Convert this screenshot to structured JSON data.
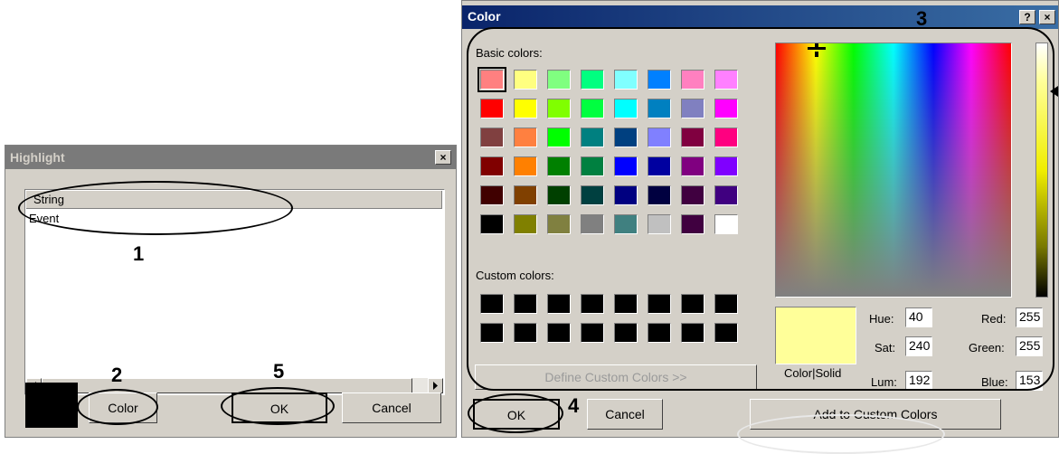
{
  "highlight_dialog": {
    "title": "Highlight",
    "close_glyph": "×",
    "list": {
      "column_header": "String",
      "rows": [
        "Event"
      ]
    },
    "swatch_color": "#000000",
    "buttons": {
      "color": "Color",
      "ok": "OK",
      "cancel": "Cancel"
    }
  },
  "color_dialog": {
    "title": "Color",
    "help_glyph": "?",
    "close_glyph": "×",
    "basic_colors_label": "Basic colors:",
    "custom_colors_label": "Custom colors:",
    "basic_colors": [
      [
        "#ff8080",
        "#ffff80",
        "#80ff80",
        "#00ff80",
        "#80ffff",
        "#0080ff",
        "#ff80c0",
        "#ff80ff"
      ],
      [
        "#ff0000",
        "#ffff00",
        "#80ff00",
        "#00ff40",
        "#00ffff",
        "#0080c0",
        "#8080c0",
        "#ff00ff"
      ],
      [
        "#804040",
        "#ff8040",
        "#00ff00",
        "#008080",
        "#004080",
        "#8080ff",
        "#800040",
        "#ff0080"
      ],
      [
        "#800000",
        "#ff8000",
        "#008000",
        "#008040",
        "#0000ff",
        "#0000a0",
        "#800080",
        "#8000ff"
      ],
      [
        "#400000",
        "#804000",
        "#004000",
        "#004040",
        "#000080",
        "#000040",
        "#400040",
        "#400080"
      ],
      [
        "#000000",
        "#808000",
        "#808040",
        "#808080",
        "#408080",
        "#c0c0c0",
        "#400040",
        "#ffffff"
      ]
    ],
    "custom_colors": [
      [
        "#000000",
        "#000000",
        "#000000",
        "#000000",
        "#000000",
        "#000000",
        "#000000",
        "#000000"
      ],
      [
        "#000000",
        "#000000",
        "#000000",
        "#000000",
        "#000000",
        "#000000",
        "#000000",
        "#000000"
      ]
    ],
    "define_custom_label": "Define Custom Colors >>",
    "color_solid_label": "Color|Solid",
    "preview_color": "#ffff99",
    "fields": {
      "hue_label": "Hue:",
      "hue": "40",
      "sat_label": "Sat:",
      "sat": "240",
      "lum_label": "Lum:",
      "lum": "192",
      "red_label": "Red:",
      "red": "255",
      "green_label": "Green:",
      "green": "255",
      "blue_label": "Blue:",
      "blue": "153"
    },
    "buttons": {
      "ok": "OK",
      "cancel": "Cancel",
      "add_custom": "Add to Custom Colors"
    }
  },
  "annotations": {
    "n1": "1",
    "n2": "2",
    "n3": "3",
    "n4": "4",
    "n5": "5"
  }
}
